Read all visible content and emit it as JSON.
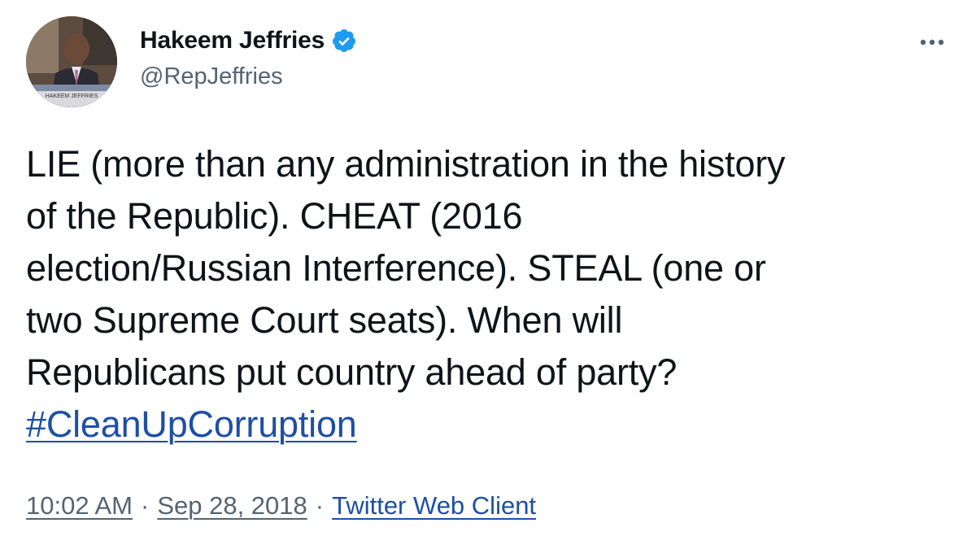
{
  "author": {
    "display_name": "Hakeem Jeffries",
    "handle": "@RepJeffries",
    "verified": true,
    "avatar_icon": "profile-photo",
    "avatar_caption": "HAKEEM JEFFRIES"
  },
  "menu": {
    "icon": "more-options-icon"
  },
  "tweet": {
    "lines": [
      "LIE (more than any administration in the history",
      "of the Republic). CHEAT (2016",
      "election/Russian Interference). STEAL (one or",
      "two Supreme Court seats). When will",
      "Republicans put country ahead of party?"
    ],
    "hashtag": "#CleanUpCorruption"
  },
  "meta": {
    "time": "10:02 AM",
    "separator": "·",
    "date": "Sep 28, 2018",
    "source": "Twitter Web Client"
  },
  "colors": {
    "text": "#0f1419",
    "secondary": "#536471",
    "link": "#1d4fa6",
    "verified": "#1d9bf0"
  }
}
